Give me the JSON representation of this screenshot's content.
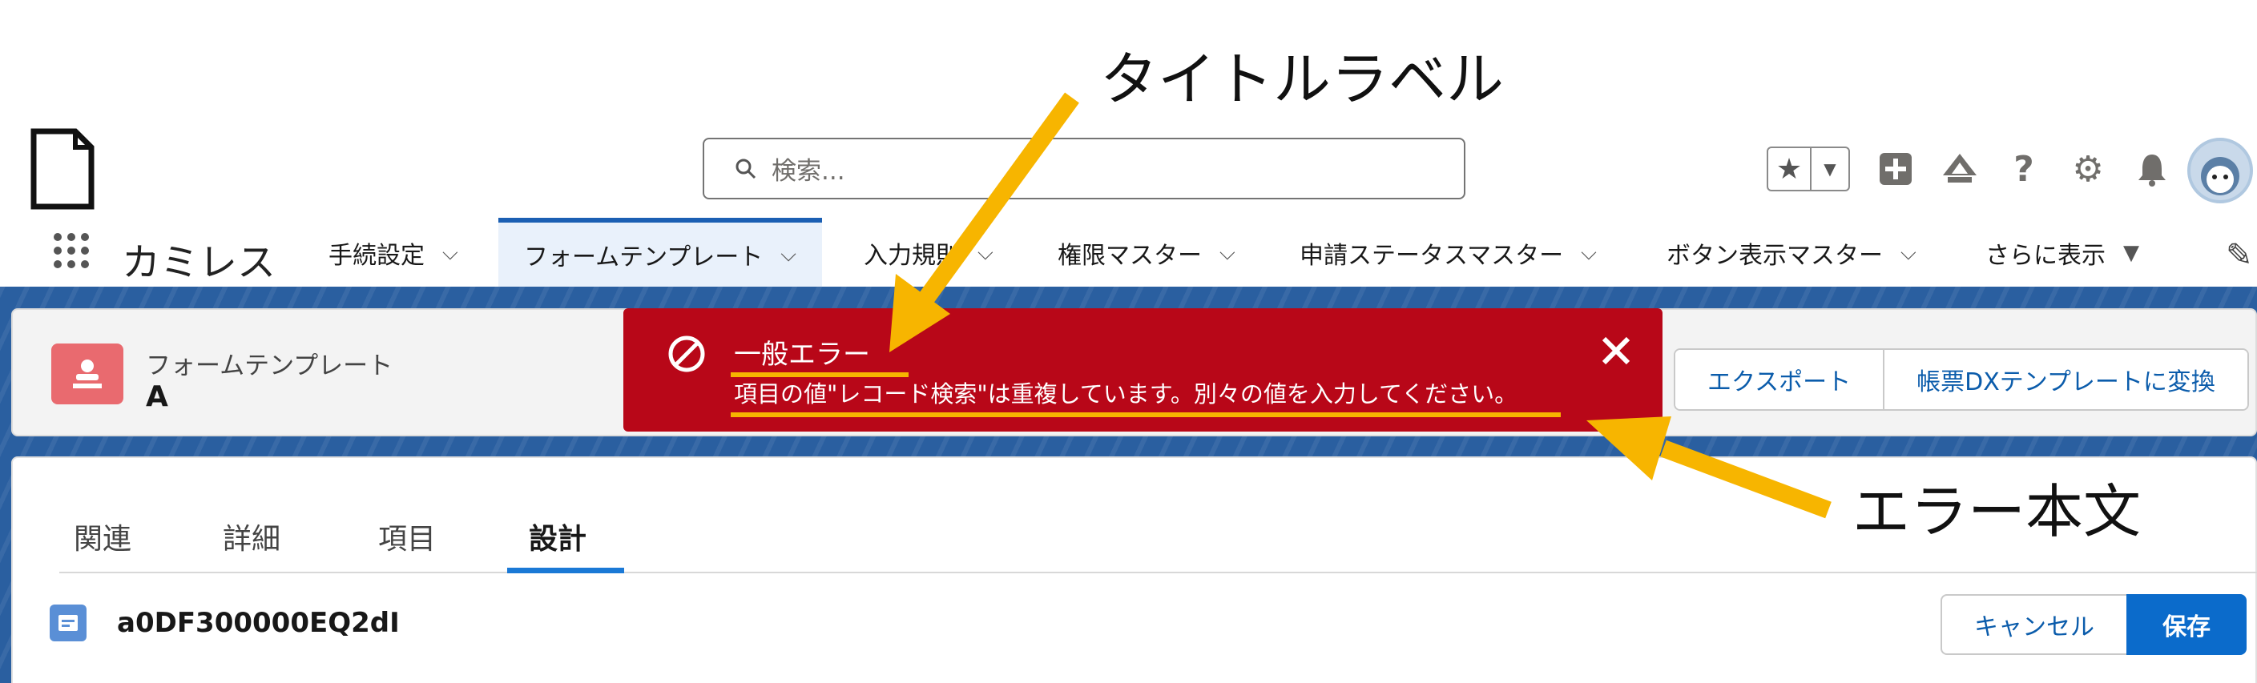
{
  "header": {
    "search_placeholder": "検索..."
  },
  "nav": {
    "app_name": "カミレス",
    "items": [
      {
        "label": "手続設定"
      },
      {
        "label": "フォームテンプレート"
      },
      {
        "label": "入力規則"
      },
      {
        "label": "権限マスター"
      },
      {
        "label": "申請ステータスマスター"
      },
      {
        "label": "ボタン表示マスター"
      },
      {
        "label": "さらに表示"
      }
    ]
  },
  "record": {
    "type_label": "フォームテンプレート",
    "name": "A",
    "actions": [
      {
        "label": "エクスポート"
      },
      {
        "label": "帳票DXテンプレートに変換"
      }
    ]
  },
  "toast": {
    "title": "一般エラー",
    "message": "項目の値\"レコード検索\"は重複しています。別々の値を入力してください。"
  },
  "detail": {
    "tabs": [
      {
        "label": "関連"
      },
      {
        "label": "詳細"
      },
      {
        "label": "項目"
      },
      {
        "label": "設計",
        "active": true
      }
    ],
    "object_name": "a0DF300000EQ2dI",
    "cancel_label": "キャンセル",
    "save_label": "保存"
  },
  "annotations": {
    "title_label": "タイトルラベル",
    "body_label": "エラー本文"
  },
  "colors": {
    "toast_bg": "#b80718",
    "brand_blue": "#0b6bcb",
    "annotation": "#f7b500"
  }
}
